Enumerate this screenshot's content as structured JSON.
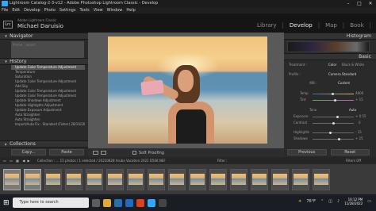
{
  "window": {
    "title": "Lightroom Catalog-2-3-v12 - Adobe Photoshop Lightroom Classic - Develop",
    "controls": [
      "–",
      "□",
      "✕"
    ]
  },
  "menu": [
    "File",
    "Edit",
    "Develop",
    "Photo",
    "Settings",
    "Tools",
    "View",
    "Window",
    "Help"
  ],
  "identity": {
    "logo": "Lrc",
    "catalog": "Adobe Lightroom Classic",
    "user": "Michael Daruisio"
  },
  "modules": {
    "library": "Library",
    "develop": "Develop",
    "map": "Map",
    "book": "Book"
  },
  "left": {
    "navigator": "Navigator",
    "fit_label": "Preset : Select",
    "history_title": "History",
    "history": [
      "Update Color Temperature Adjustment",
      "Temperature",
      "Saturation",
      "Update Color Temperature Adjustment",
      "Add Sky",
      "Update Color Temperature Adjustment",
      "Update Color Temperature Adjustment",
      "Update Shadows Adjustment",
      "Update Highlights Adjustment",
      "Update Exposure Adjustment",
      "Auto Straighten",
      "Auto Straighten",
      "Import/Auto Fix - Standard (Fisher) 28/10/2022 1"
    ],
    "collections": "Collections",
    "copy": "Copy...",
    "paste": "Paste"
  },
  "toolbar": {
    "soft_proofing": "Soft Proofing"
  },
  "right": {
    "histogram": "Histogram",
    "basic": "Basic",
    "treatment": "Treatment :",
    "color": "Color",
    "bw": "Black & White",
    "profile": "Profile :",
    "profile_val": "Camera Standard",
    "wb": "WB :",
    "wb_val": "Custom",
    "temp": "Temp",
    "temp_val": "4800",
    "tint": "Tint",
    "tint_val": "+ 15",
    "tone": "Tone",
    "auto": "Auto",
    "exposure": "Exposure",
    "exposure_val": "+ 0.55",
    "contrast": "Contrast",
    "contrast_val": "0",
    "highlights": "Highlights",
    "highlights_val": "- 15",
    "shadows": "Shadows",
    "shadows_val": "+ 25",
    "previous": "Previous",
    "reset": "Reset"
  },
  "filmstrip_bar": {
    "path": "Collection : ... 15 photos / 1 selected / 20220828 Aruba Vacation 2022 D5EK.NEF",
    "filter": "Filter :",
    "filters_off": "Filters Off"
  },
  "filmstrip": {
    "count": 16,
    "selected": [
      0,
      1
    ]
  },
  "taskbar": {
    "search": "Type here to search",
    "weather": "76°F",
    "time": "10:12 PM",
    "date": "11/28/2022"
  },
  "colors": {
    "accent": "#31a8ff",
    "panel": "#2a2a2a"
  }
}
